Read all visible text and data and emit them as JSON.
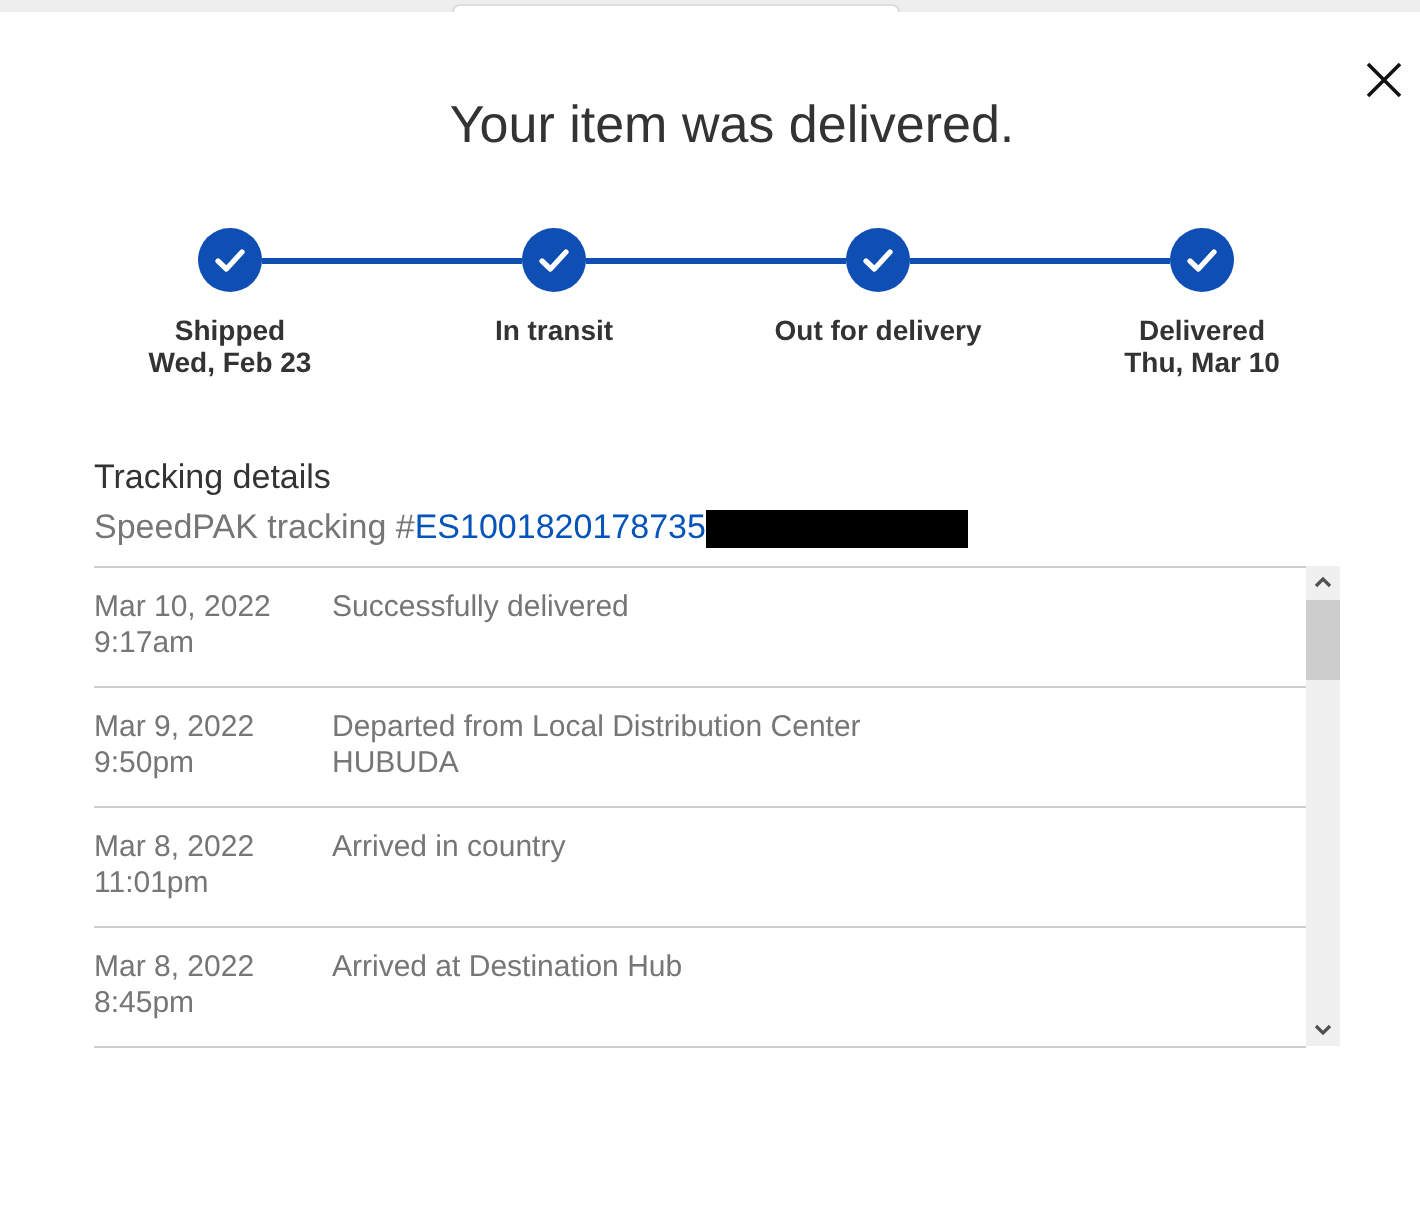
{
  "dialog": {
    "title": "Your item was delivered."
  },
  "progress": {
    "steps": [
      {
        "label": "Shipped",
        "date": "Wed, Feb 23",
        "completed": true
      },
      {
        "label": "In transit",
        "completed": true
      },
      {
        "label": "Out for delivery",
        "completed": true
      },
      {
        "label": "Delivered",
        "date": "Thu, Mar 10",
        "completed": true
      }
    ]
  },
  "tracking": {
    "heading": "Tracking details",
    "carrier_label": "SpeedPAK tracking #",
    "number": "ES1001820178735",
    "redacted": true
  },
  "events": [
    {
      "date": "Mar 10, 2022",
      "time": "9:17am",
      "description": "Successfully delivered"
    },
    {
      "date": "Mar 9, 2022",
      "time": "9:50pm",
      "description": "Departed from Local Distribution Center",
      "location": "HUBUDA"
    },
    {
      "date": "Mar 8, 2022",
      "time": "11:01pm",
      "description": "Arrived in country"
    },
    {
      "date": "Mar 8, 2022",
      "time": "8:45pm",
      "description": "Arrived at Destination Hub"
    }
  ]
}
